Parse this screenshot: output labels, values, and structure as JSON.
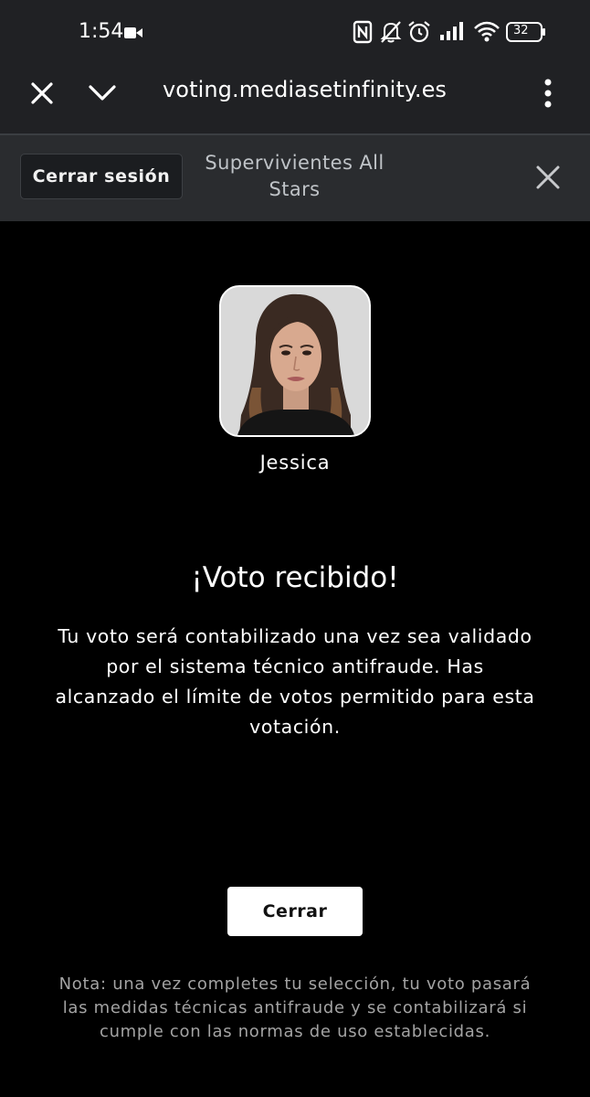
{
  "status_bar": {
    "time": "1:54",
    "battery": "32",
    "icons": [
      "video-camera-icon",
      "nfc-icon",
      "bell-off-icon",
      "alarm-icon",
      "signal-icon",
      "wifi-icon",
      "battery-icon"
    ]
  },
  "browser": {
    "url": "voting.mediasetinfinity.es",
    "icons": [
      "close-icon",
      "chevron-down-icon",
      "more-vertical-icon"
    ]
  },
  "header": {
    "logout_label": "Cerrar sesión",
    "title": "Supervivientes All Stars",
    "close_icon": "close-icon"
  },
  "contestant": {
    "name": "Jessica"
  },
  "confirmation": {
    "title": "¡Voto recibido!",
    "message": "Tu voto será contabilizado una vez sea validado por el sistema técnico antifraude. Has alcanzado el límite de votos permitido para esta votación.",
    "close_label": "Cerrar",
    "note": "Nota: una vez completes tu selección, tu voto pasará las medidas técnicas antifraude y se contabilizará si cumple con las normas de uso establecidas."
  },
  "colors": {
    "background": "#000000",
    "chrome": "#202124",
    "appbar": "#2a2c2f",
    "note_text": "#a3a3a3"
  }
}
